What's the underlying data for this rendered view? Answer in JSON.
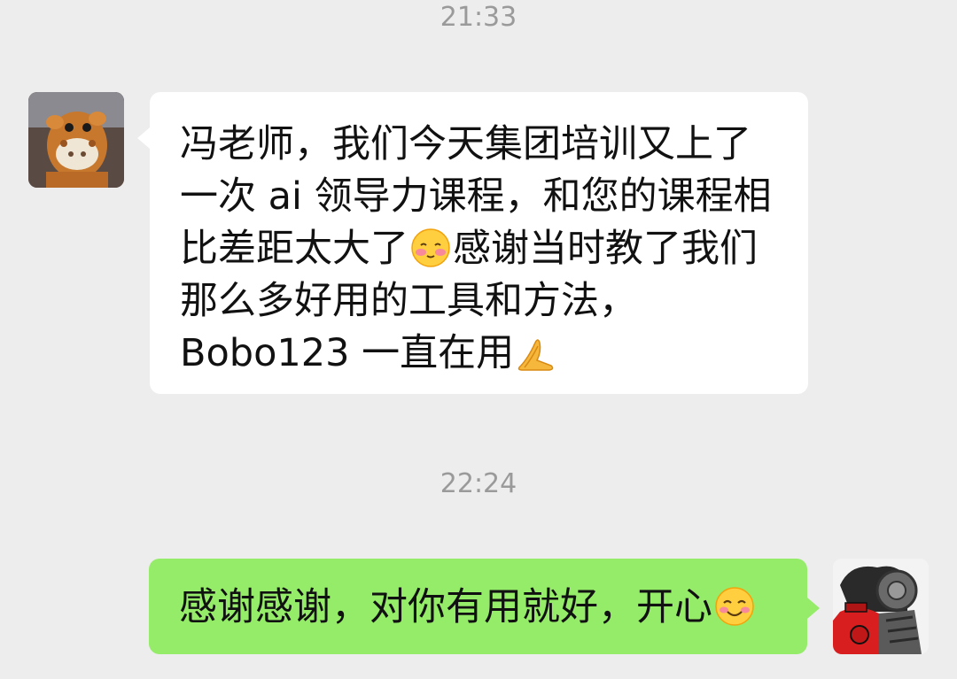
{
  "chat": {
    "timestamps": [
      "21:33",
      "22:24"
    ],
    "incoming": {
      "avatar_icon": "giraffe-plush-avatar",
      "lines": [
        "冯老师，我们今天集团培训又上了",
        "一次 ai 领导力课程，和您的课程相",
        "比差距太大了",
        "感谢当时教了我们",
        "那么多好用的工具和方法，",
        "Bobo123 一直在用"
      ],
      "emojis": [
        "shy-blush-emoji",
        "praying-hands-emoji"
      ]
    },
    "outgoing": {
      "avatar_icon": "illustrated-character-avatar",
      "text": "感谢感谢，对你有用就好，开心",
      "emoji": "smiling-face-emoji"
    }
  },
  "colors": {
    "background": "#ededed",
    "incoming_bubble": "#ffffff",
    "outgoing_bubble": "#95ec69",
    "timestamp": "#9a9a9a"
  }
}
